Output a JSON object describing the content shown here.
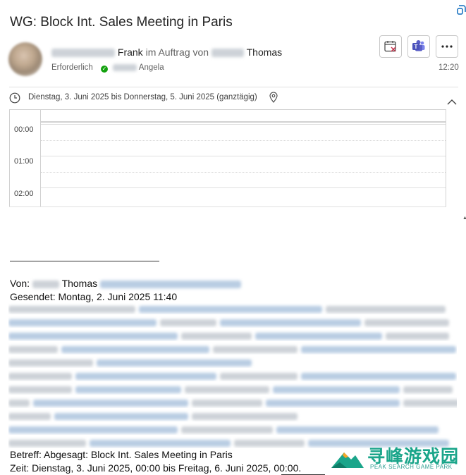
{
  "header": {
    "subject": "WG: Block Int. Sales Meeting in Paris",
    "from_name": "Frank",
    "on_behalf_text": "im Auftrag von",
    "on_behalf_name": "Thomas",
    "required_label": "Erforderlich",
    "attendee_name": "Angela",
    "time": "12:20"
  },
  "actions": [
    {
      "name": "decline-calendar-button",
      "icon": "calendar-x-icon"
    },
    {
      "name": "teams-button",
      "icon": "teams-icon"
    },
    {
      "name": "more-button",
      "icon": "ellipsis-icon"
    }
  ],
  "event": {
    "date_text": "Dienstag, 3. Juni 2025 bis Donnerstag, 5. Juni 2025 (ganztägig)"
  },
  "calendar": {
    "hours": [
      "00:00",
      "01:00",
      "02:00"
    ]
  },
  "body": {
    "from_label": "Von:",
    "from_name": "Thomas",
    "sent": "Gesendet: Montag, 2. Juni 2025 11:40",
    "subject_line": "Betreff: Abgesagt: Block Int. Sales Meeting in Paris",
    "time_line": "Zeit: Dienstag, 3. Juni 2025, 00:00 bis Freitag, 6. Juni 2025, 00:00."
  },
  "watermark": {
    "title": "寻峰游戏园",
    "subtitle": "PEAK SEARCH GAME PARK"
  },
  "colors": {
    "accent": "#0f6cbd",
    "success": "#13a10e",
    "teams": "#5b5fc7",
    "watermark": "#1aa58a"
  }
}
